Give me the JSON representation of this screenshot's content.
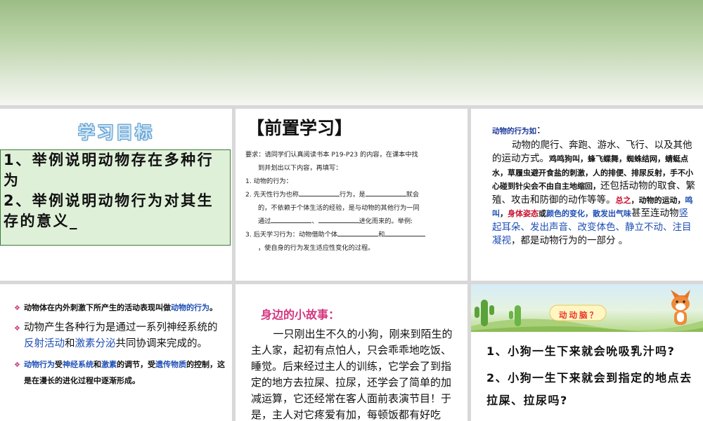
{
  "tile1": {
    "title": "学习目标",
    "goals": [
      "1、举例说明动物存在多种行为",
      "2、举例说明动物行为对其生存的意义"
    ]
  },
  "tile2": {
    "title": "【前置学习】",
    "req_a": "要求：请同学们认真阅读书本 P19-P23 的内容，在课本中找",
    "req_b": "到并划出以下内容，再填写：",
    "q1": "1. 动物的行为：",
    "q2_a": "2. 先天性行为也称",
    "q2_b": "行为，是",
    "q2_c": "就会",
    "q2_d": "的，不依赖于个体生活的经验，是与动物的其他行为一同",
    "q2_e": "通过",
    "q2_f": "、",
    "q2_g": "进化而来的。举例:",
    "q3_a": "3. 后天学习行为：动物借助个体",
    "q3_b": "和",
    "q3_c": "，使自身的行为发生适应性变化的过程。"
  },
  "tile3": {
    "heading": "动物的行为如",
    "colon": "：",
    "s1": "动物的爬行、奔跑、游水、飞行、以及其他的运动方式。",
    "s2": "鸡鸣狗叫，蜂飞蝶舞，蜘蛛结网，蜻蜓点水，草履虫避开食盐的刺激，人的排便、排尿反射，手不小心碰到针尖会不由自主地缩回，",
    "s3": "还包括动物的取食、繁殖、攻击和防御的动作等等。",
    "s4": "总之",
    "s5": "，动物的运动，",
    "s6": "鸣叫",
    "s7": "，",
    "s8": "身体姿态",
    "s9": "或",
    "s10": "颜色的变化，散发出气味",
    "s11": "甚至连动物",
    "s12": "竖起耳朵、发出声音、改变体色、静立不动、注目凝视",
    "s13": "，都是动物行为的一部分 。"
  },
  "tile4": {
    "b1_a": "动物体在内外刺激下所产生的活动表现叫做",
    "b1_b": "动物的行为",
    "b1_c": "。",
    "b2_a": "动物产生各种行为是通过一系列神经系统的",
    "b2_b": "反射活动",
    "b2_c": "和",
    "b2_d": "激素分泌",
    "b2_e": "共同协调来完成的。",
    "b3_a": "动物行为",
    "b3_b": "受",
    "b3_c": "神经系统",
    "b3_d": "和",
    "b3_e": "激素",
    "b3_f": "的调节，受",
    "b3_g": "遗传物质",
    "b3_h": "的控制，这是在漫长的进化过程中逐渐形成。"
  },
  "tile5": {
    "title": "身边的小故事：",
    "story": "一只刚出生不久的小狗，刚来到陌生的主人家，起初有点怕人，只会乖乖地吃饭、睡觉。后来经过主人的训练，它学会了到指定的地方去拉屎、拉尿，还学会了简单的加减运算，它还经常在客人面前表演节目！于是，主人对它疼爱有加，每顿饭都有好吃的，还时"
  },
  "tile6": {
    "title": "动动脑？",
    "q1": "1、小狗一生下来就会吮吸乳汁吗?",
    "q2": "2、小狗一生下来就会到指定的地点去拉屎、拉尿吗?"
  },
  "colors": {
    "banner": "#9cbd86",
    "goal_bg": "#dff0d8",
    "red": "#c8102e",
    "blue": "#1f4fb5",
    "pink": "#d4357f"
  }
}
